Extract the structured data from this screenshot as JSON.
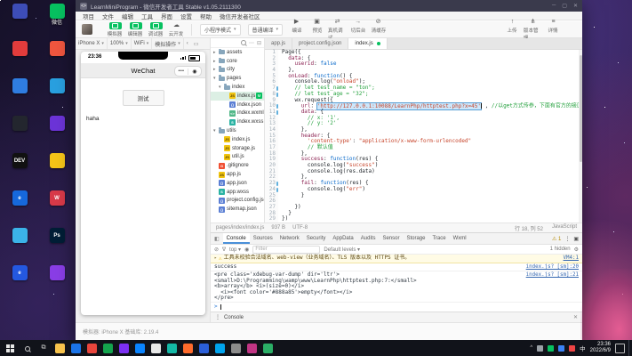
{
  "colors": {
    "accent_green": "#07c160",
    "title_bar": "#3a3a4c",
    "warning_bg": "#fffbe5"
  },
  "desktop": {
    "icon_columns": [
      [
        {
          "color": "#3d4db7",
          "glyph": "",
          "label": ""
        },
        {
          "color": "#e23c3c",
          "glyph": "",
          "label": ""
        },
        {
          "color": "#2f7de1",
          "glyph": "",
          "label": ""
        },
        {
          "color": "#23262e",
          "glyph": "",
          "label": ""
        },
        {
          "color": "#111111",
          "glyph": "DEV",
          "label": ""
        },
        {
          "color": "#1668dc",
          "glyph": "e",
          "label": ""
        },
        {
          "color": "#3bb3e8",
          "glyph": "",
          "label": ""
        },
        {
          "color": "#2458e0",
          "glyph": "e",
          "label": ""
        }
      ],
      [
        {
          "color": "#07c160",
          "glyph": "",
          "label": "微信"
        },
        {
          "color": "#f0563f",
          "glyph": "",
          "label": ""
        },
        {
          "color": "#29a0e0",
          "glyph": "",
          "label": ""
        },
        {
          "color": "#6c34d8",
          "glyph": "",
          "label": ""
        },
        {
          "color": "#f5c518",
          "glyph": "",
          "label": ""
        },
        {
          "color": "#d93a49",
          "glyph": "W",
          "label": ""
        },
        {
          "color": "#001e36",
          "glyph": "Ps",
          "label": ""
        },
        {
          "color": "#8a3ee6",
          "glyph": "",
          "label": ""
        }
      ]
    ],
    "taskbar": {
      "time": "23:36",
      "date": "2022/6/9",
      "input_indicator": "中",
      "pinned_colors": [
        "#f7c34c",
        "#1b74e8",
        "#e8453c",
        "#14a44d",
        "#7b2ff2",
        "#0a84ff",
        "#e8e8e8",
        "#14b8a6",
        "#ff6b2c",
        "#2b5fd9",
        "#00a4ef",
        "#8c8c8c",
        "#c13584",
        "#2bae66"
      ],
      "tray_colors": [
        "#9aa0a6",
        "#07c160",
        "#3b82f6",
        "#ef4444"
      ]
    }
  },
  "window": {
    "title": "LearnMiniProgram - 微信开发者工具 Stable v1.05.2111300",
    "menu": [
      "项目",
      "文件",
      "编辑",
      "工具",
      "界面",
      "设置",
      "帮助",
      "微信开发者社区"
    ],
    "toolbar": {
      "toggles": [
        {
          "label": "模拟器"
        },
        {
          "label": "编辑器"
        },
        {
          "label": "调试器"
        }
      ],
      "cloud_label": "云开发",
      "mode_select": "小程序模式",
      "compile_select": "普通编译",
      "actions": [
        {
          "label": "编译",
          "name": "compile"
        },
        {
          "label": "预览",
          "name": "preview"
        },
        {
          "label": "真机调试",
          "name": "remote-debug"
        },
        {
          "label": "切后台",
          "name": "background"
        },
        {
          "label": "清缓存",
          "name": "clear-cache"
        }
      ],
      "right_actions": [
        {
          "label": "上传",
          "name": "upload"
        },
        {
          "label": "版本管理",
          "name": "version"
        },
        {
          "label": "详情",
          "name": "details"
        }
      ]
    },
    "simulator": {
      "dropdowns": [
        "iPhone X",
        "100%",
        "WiFi",
        "模拟操作"
      ],
      "phone": {
        "time": "23:36",
        "nav_title": "WeChat",
        "capsule_more": "•••",
        "capsule_home": "◉",
        "button_label": "测试",
        "message": "haha"
      }
    },
    "explorer": {
      "items": [
        {
          "type": "folder",
          "depth": 0,
          "label": "assets",
          "expanded": false
        },
        {
          "type": "folder",
          "depth": 0,
          "label": "core",
          "expanded": false
        },
        {
          "type": "folder",
          "depth": 0,
          "label": "city",
          "expanded": false
        },
        {
          "type": "folder",
          "depth": 0,
          "label": "pages",
          "expanded": true
        },
        {
          "type": "folder",
          "depth": 1,
          "label": "index",
          "expanded": true
        },
        {
          "type": "file",
          "depth": 2,
          "label": "index.js",
          "icon": "js",
          "selected": true,
          "badge": "M"
        },
        {
          "type": "file",
          "depth": 2,
          "label": "index.json",
          "icon": "json"
        },
        {
          "type": "file",
          "depth": 2,
          "label": "index.wxml",
          "icon": "wxml"
        },
        {
          "type": "file",
          "depth": 2,
          "label": "index.wxss",
          "icon": "wxss"
        },
        {
          "type": "folder",
          "depth": 0,
          "label": "utils",
          "expanded": true
        },
        {
          "type": "file",
          "depth": 1,
          "label": "index.js",
          "icon": "js"
        },
        {
          "type": "file",
          "depth": 1,
          "label": "storage.js",
          "icon": "js"
        },
        {
          "type": "file",
          "depth": 1,
          "label": "util.js",
          "icon": "js"
        },
        {
          "type": "file",
          "depth": 0,
          "label": ".gitignore",
          "icon": "git"
        },
        {
          "type": "file",
          "depth": 0,
          "label": "app.js",
          "icon": "js"
        },
        {
          "type": "file",
          "depth": 0,
          "label": "app.json",
          "icon": "json"
        },
        {
          "type": "file",
          "depth": 0,
          "label": "app.wxss",
          "icon": "wxss"
        },
        {
          "type": "file",
          "depth": 0,
          "label": "project.config.json",
          "icon": "json"
        },
        {
          "type": "file",
          "depth": 0,
          "label": "sitemap.json",
          "icon": "json"
        }
      ]
    },
    "editor": {
      "tabs": [
        {
          "label": "app.js",
          "active": false,
          "modified": false
        },
        {
          "label": "project.config.json",
          "active": false,
          "modified": false
        },
        {
          "label": "index.js",
          "active": true,
          "modified": true
        }
      ],
      "code": [
        "Page({",
        "  data: {",
        "    userid: false",
        "  },",
        "  onLoad: function() {",
        "    console.log(\"onload\");",
        "    // let test_name = \"ton\";",
        "    // let test_age = \"32\";",
        "    wx.request({",
        "      url: 'http://127.0.0.1:10088/LearnPhp/httptest.php?x=45' , //以get方式传参，下面有官方的接口样式",
        "      data: {",
        "        // x: '1',",
        "        // y: '2'",
        "      },",
        "      header: {",
        "        'content-type': \"application/x-www-form-urlencoded\"",
        "        // 默认值",
        "      },",
        "      success: function(res) {",
        "        console.log(\"success\")",
        "        console.log(res.data)",
        "      },",
        "      fail: function(res) {",
        "        console.log(\"err\")",
        "      }",
        "",
        "    })",
        "  }",
        "})"
      ],
      "changed_lines": [
        7,
        8,
        10,
        11,
        23,
        24
      ],
      "selected_text": "http://127.0.0.1:10088/LearnPhp/httptest.php?x=45",
      "status": {
        "path": "pages/index/index.js",
        "size": "937 B",
        "encoding": "UTF-8",
        "cursor": "行 18, 列 52",
        "language": "JavaScript"
      }
    },
    "debugger": {
      "tabs": [
        "Console",
        "Sources",
        "Network",
        "Security",
        "AppData",
        "Audits",
        "Sensor",
        "Storage",
        "Trace",
        "Wxml"
      ],
      "active_tab": "Console",
      "warning_count": "1",
      "toolbar": {
        "context": "top",
        "filter_placeholder": "Filter",
        "levels": "Default levels",
        "hidden_label": "1 hidden"
      },
      "messages": [
        {
          "type": "warning",
          "lines": [
            "工具未校验合法域名、web-view（业务域名）、TLS 版本以及 HTTPS 证书。"
          ],
          "source": "VM4:1"
        },
        {
          "type": "log",
          "lines": [
            "success"
          ],
          "source": "index.js? [sm]:20"
        },
        {
          "type": "log",
          "lines": [
            "<pre class='xdebug-var-dump' dir='ltr'>",
            "<small>D:\\Programming\\wamp\\www\\LearnPhp\\httptest.php:7:</small>",
            "<b>array</b> <i>(size=0)</i>",
            "  <i><font color='#888a85'>empty</font></i>",
            "</pre>"
          ],
          "source": "index.js? [sm]:21"
        }
      ],
      "prompt": ">",
      "drawer_label": "Console"
    },
    "footer": {
      "left": "模拟器: iPhone X  基础库: 2.19.4"
    }
  }
}
